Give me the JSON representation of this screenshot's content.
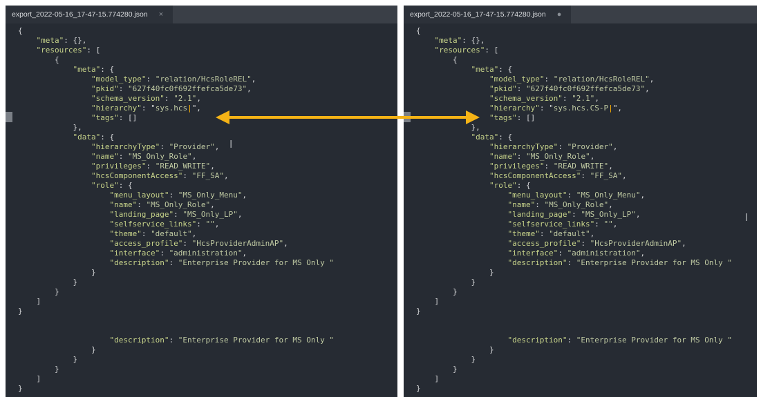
{
  "left": {
    "tab_title": "export_2022-05-16_17-47-15.774280.json",
    "tab_close": "×",
    "hierarchy_value": "sys.hcs",
    "caret": "|"
  },
  "right": {
    "tab_title": "export_2022-05-16_17-47-15.774280.json",
    "tab_dirty": "●",
    "hierarchy_value": "sys.hcs.CS-P",
    "caret": "|"
  },
  "json": {
    "meta_key": "\"meta\"",
    "resources_key": "\"resources\"",
    "model_type_key": "\"model_type\"",
    "model_type_val": "\"relation/HcsRoleREL\"",
    "pkid_key": "\"pkid\"",
    "pkid_val": "\"627f40fc0f692ffefca5de73\"",
    "schema_key": "\"schema_version\"",
    "schema_val": "\"2.1\"",
    "hierarchy_key": "\"hierarchy\"",
    "tags_key": "\"tags\"",
    "data_key": "\"data\"",
    "hierarchyType_key": "\"hierarchyType\"",
    "hierarchyType_val": "\"Provider\"",
    "name_key": "\"name\"",
    "name_val": "\"MS_Only_Role\"",
    "privileges_key": "\"privileges\"",
    "privileges_val": "\"READ_WRITE\"",
    "hcs_key": "\"hcsComponentAccess\"",
    "hcs_val": "\"FF_SA\"",
    "role_key": "\"role\"",
    "menu_key": "\"menu_layout\"",
    "menu_val": "\"MS_Only_Menu\"",
    "landing_key": "\"landing_page\"",
    "landing_val": "\"MS_Only_LP\"",
    "self_key": "\"selfservice_links\"",
    "self_val": "\"\"",
    "theme_key": "\"theme\"",
    "theme_val": "\"default\"",
    "access_key": "\"access_profile\"",
    "access_val": "\"HcsProviderAdminAP\"",
    "interface_key": "\"interface\"",
    "interface_val": "\"administration\"",
    "desc_key": "\"description\"",
    "desc_val": "\"Enterprise Provider for MS Only \""
  },
  "colors": {
    "accent_arrow": "#f5b316",
    "editor_bg": "#262b33",
    "caret": "#ffb000"
  },
  "icons": {
    "arrow": "double-headed-arrow",
    "ibeam": "text-cursor"
  }
}
